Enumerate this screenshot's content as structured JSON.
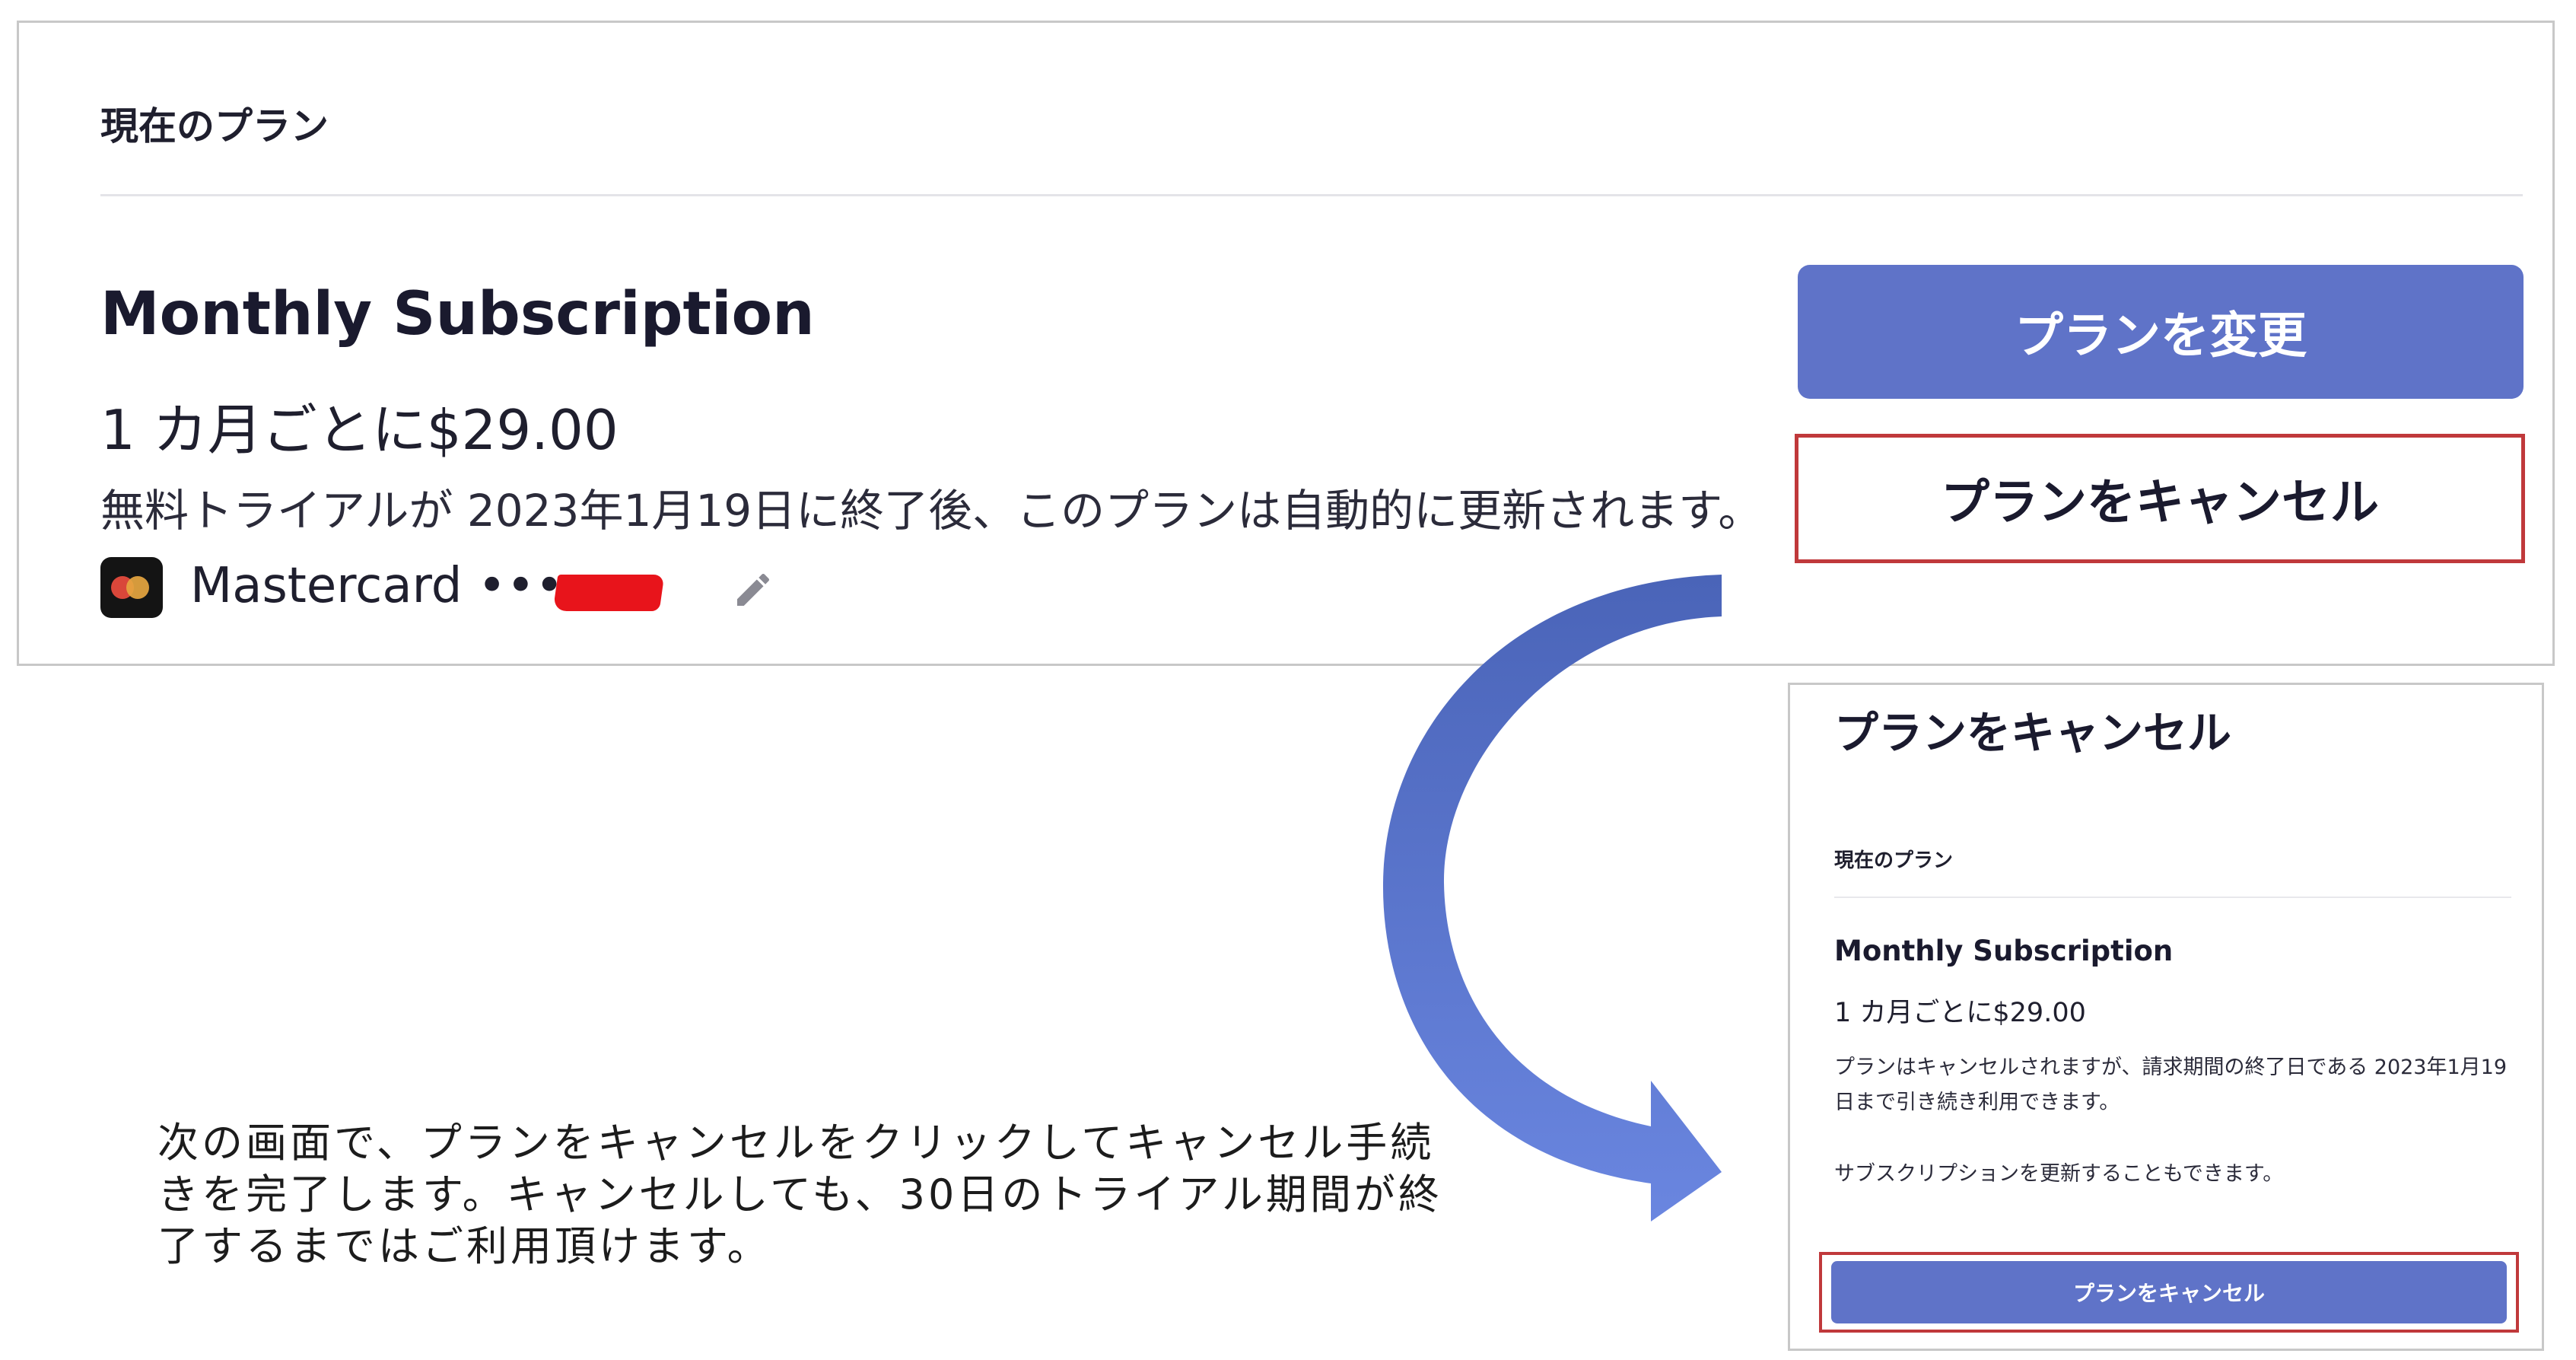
{
  "current_plan_panel": {
    "section_title": "現在のプラン",
    "plan_name": "Monthly Subscription",
    "price_text": "1 カ月ごとに$29.00",
    "renewal_note": "無料トライアルが 2023年1月19日に終了後、このプランは自動的に更新されます。",
    "payment": {
      "card_label": "Mastercard ••••",
      "card_icon": "mastercard-icon",
      "edit_icon": "pencil-icon"
    },
    "change_plan_label": "プランを変更",
    "cancel_plan_label": "プランをキャンセル"
  },
  "instruction": {
    "text": "次の画面で、プランをキャンセルをクリックしてキャンセル手続きを完了します。キャンセルしても、30日のトライアル期間が終了するまではご利用頂けます。"
  },
  "cancel_dialog": {
    "title": "プランをキャンセル",
    "section_title": "現在のプラン",
    "plan_name": "Monthly Subscription",
    "price_text": "1 カ月ごとに$29.00",
    "cancel_note": "プランはキャンセルされますが、請求期間の終了日である 2023年1月19日まで引き続き利用できます。",
    "renew_note": "サブスクリプションを更新することもできます。",
    "cancel_button_label": "プランをキャンセル"
  },
  "colors": {
    "primary_button": "#5f73c8",
    "highlight_border": "#c0393b",
    "redaction": "#e8141b",
    "arrow_top": "#4a64b8",
    "arrow_bottom": "#6a86e0"
  }
}
